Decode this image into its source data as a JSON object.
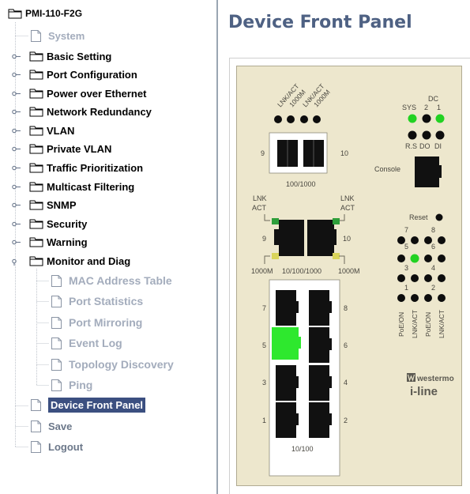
{
  "nav": {
    "root_label": "PMI-110-F2G",
    "items": [
      {
        "label": "System",
        "kind": "page",
        "level": 1
      },
      {
        "label": "Basic Setting",
        "kind": "folder",
        "level": 1
      },
      {
        "label": "Port Configuration",
        "kind": "folder",
        "level": 1
      },
      {
        "label": "Power over Ethernet",
        "kind": "folder",
        "level": 1
      },
      {
        "label": "Network Redundancy",
        "kind": "folder",
        "level": 1
      },
      {
        "label": "VLAN",
        "kind": "folder",
        "level": 1
      },
      {
        "label": "Private VLAN",
        "kind": "folder",
        "level": 1
      },
      {
        "label": "Traffic Prioritization",
        "kind": "folder",
        "level": 1
      },
      {
        "label": "Multicast Filtering",
        "kind": "folder",
        "level": 1
      },
      {
        "label": "SNMP",
        "kind": "folder",
        "level": 1
      },
      {
        "label": "Security",
        "kind": "folder",
        "level": 1
      },
      {
        "label": "Warning",
        "kind": "folder",
        "level": 1
      },
      {
        "label": "Monitor and Diag",
        "kind": "folder-open",
        "level": 1
      },
      {
        "label": "MAC Address Table",
        "kind": "page",
        "level": 2
      },
      {
        "label": "Port Statistics",
        "kind": "page",
        "level": 2
      },
      {
        "label": "Port Mirroring",
        "kind": "page",
        "level": 2
      },
      {
        "label": "Event Log",
        "kind": "page",
        "level": 2
      },
      {
        "label": "Topology Discovery",
        "kind": "page",
        "level": 2
      },
      {
        "label": "Ping",
        "kind": "page",
        "level": 2
      },
      {
        "label": "Device Front Panel",
        "kind": "page",
        "level": 1,
        "selected": true
      },
      {
        "label": "Save",
        "kind": "page",
        "level": 1
      },
      {
        "label": "Logout",
        "kind": "page",
        "level": 1
      }
    ]
  },
  "main": {
    "title": "Device Front Panel"
  },
  "panel": {
    "top_led_labels": [
      "LNK/ACT",
      "1000M",
      "LNK/ACT",
      "1000M"
    ],
    "status_labels": {
      "dc": "DC",
      "sys": "SYS",
      "dc2": "2",
      "dc1": "1"
    },
    "status_bottom_labels": {
      "rs": "R.S",
      "do": "DO",
      "di": "DI"
    },
    "sfp_port_left": "9",
    "sfp_port_right": "10",
    "sfp_speed": "100/1000",
    "console_label": "Console",
    "reset_label": "Reset",
    "rj_left_top": "LNK\nACT",
    "rj_right_top": "LNK\nACT",
    "rj_port_left": "9",
    "rj_port_right": "10",
    "rj_speed_left": "1000M",
    "rj_speed_mid": "10/100/1000",
    "rj_speed_right": "1000M",
    "port_numbers": [
      "7",
      "8",
      "5",
      "6",
      "3",
      "4",
      "1",
      "2"
    ],
    "port_block_speed": "10/100",
    "port_led_numbers": [
      "7",
      "8",
      "5",
      "6",
      "3",
      "4",
      "1",
      "2"
    ],
    "port_led_bottom": [
      "PoE/ON",
      "LNK/ACT",
      "PoE/ON",
      "LNK/ACT"
    ],
    "brand_name": "westermo",
    "brand_line": "i-line",
    "colors": {
      "led_on": "#22d222",
      "led_off": "#0d0d0d",
      "link_green": "#2e9e3a",
      "speed_yellow": "#d9d45a",
      "panel_bg": "#ede7cd"
    }
  }
}
